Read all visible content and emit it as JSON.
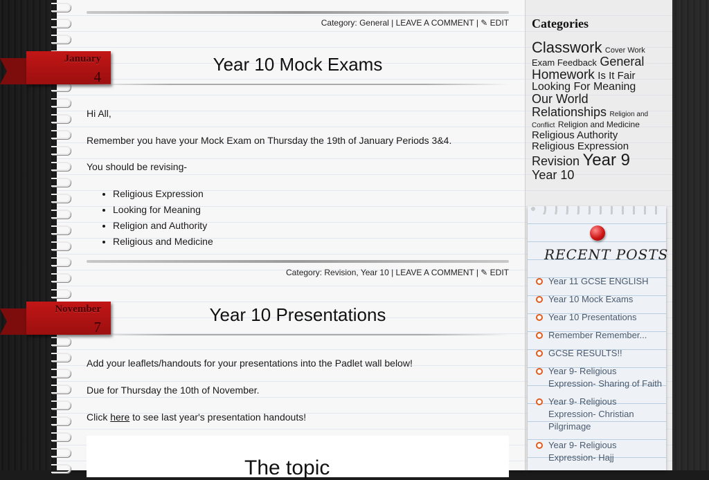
{
  "posts": [
    {
      "category_meta": "Category: General | LEAVE A COMMENT | ✎ EDIT",
      "ribbon": {
        "month": "January",
        "day": "4"
      },
      "title": "Year 10 Mock Exams",
      "greeting": "Hi All,",
      "line1": "Remember you have your Mock Exam on Thursday the 19th of January Periods 3&4.",
      "line2": "You should be revising-",
      "items": [
        "Religious Expression",
        "Looking for Meaning",
        "Religion and Authority",
        "Religious and Medicine"
      ],
      "footer_meta": "Category: Revision, Year 10 | LEAVE A COMMENT | ✎ EDIT"
    },
    {
      "ribbon": {
        "month": "November",
        "day": "7"
      },
      "title": "Year 10 Presentations",
      "line1": "Add your leaflets/handouts for your presentations into the Padlet wall below!",
      "line2": "Due for Thursday the 10th of November.",
      "line3_prefix": "Click ",
      "line3_link": "here",
      "line3_suffix": " to see last year's presentation handouts!",
      "embed_text": "The topic"
    }
  ],
  "sidebar": {
    "categories_heading": "Categories",
    "tags": [
      {
        "label": "Classwork",
        "size": 22
      },
      {
        "label": "Cover Work",
        "size": 11
      },
      {
        "label": "Exam Feedback",
        "size": 13
      },
      {
        "label": "General",
        "size": 18
      },
      {
        "label": "Homework",
        "size": 19
      },
      {
        "label": "Is It Fair",
        "size": 15
      },
      {
        "label": "Looking For Meaning",
        "size": 16
      },
      {
        "label": "Our World",
        "size": 18
      },
      {
        "label": "Relationships",
        "size": 18
      },
      {
        "label": "Religion and Conflict",
        "size": 10
      },
      {
        "label": "Religion and Medicine",
        "size": 12
      },
      {
        "label": "Religious Authority",
        "size": 15
      },
      {
        "label": "Religious Expression",
        "size": 15
      },
      {
        "label": "Revision",
        "size": 18
      },
      {
        "label": "Year 9",
        "size": 24
      },
      {
        "label": "Year 10",
        "size": 18
      }
    ],
    "recent_heading": "RECENT POSTS",
    "recent_posts": [
      "Year 11 GCSE ENGLISH",
      "Year 10 Mock Exams",
      "Year 10 Presentations",
      "Remember Remember...",
      "GCSE RESULTS!!",
      "Year 9- Religious Expression- Sharing of Faith",
      "Year 9- Religious Expression- Christian Pilgrimage",
      "Year 9- Religious Expression- Hajj"
    ]
  },
  "colors": {
    "ribbon": "#c21616",
    "bullet": "#e25a1c",
    "pin": "#d01818"
  }
}
